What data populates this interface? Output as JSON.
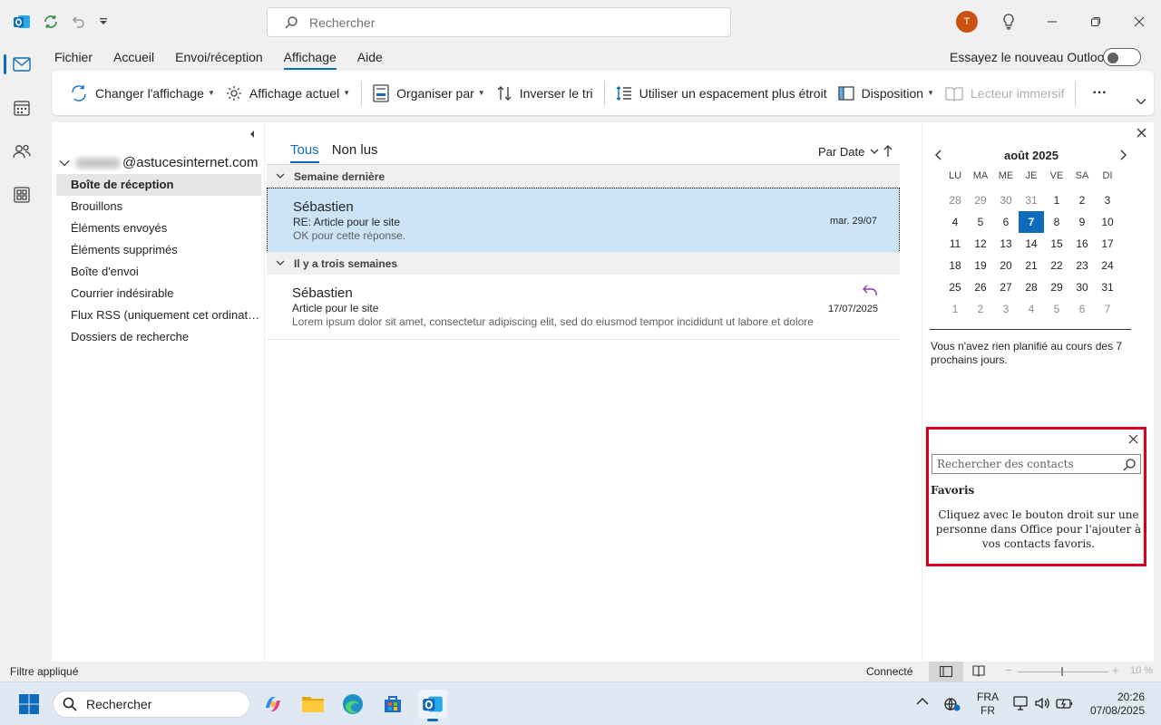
{
  "search": {
    "placeholder": "Rechercher"
  },
  "user": {
    "initial": "T"
  },
  "menu": [
    "Fichier",
    "Accueil",
    "Envoi/réception",
    "Affichage",
    "Aide"
  ],
  "try_new": "Essayez le nouveau Outlook",
  "ribbon": {
    "change_view": "Changer l'affichage",
    "current_view": "Affichage actuel",
    "arrange_by": "Organiser par",
    "reverse_sort": "Inverser le tri",
    "compact": "Utiliser un espacement plus étroit",
    "layout": "Disposition",
    "immersive_reader": "Lecteur immersif",
    "more": "···"
  },
  "account": {
    "email_suffix": "@astucesinternet.com"
  },
  "folders": [
    "Boîte de réception",
    "Brouillons",
    "Éléments envoyés",
    "Éléments supprimés",
    "Boîte d'envoi",
    "Courrier indésirable",
    "Flux RSS (uniquement cet ordinate...",
    "Dossiers de recherche"
  ],
  "list": {
    "tab_all": "Tous",
    "tab_unread": "Non lus",
    "sort": "Par Date",
    "groups": [
      {
        "title": "Semaine dernière",
        "messages": [
          {
            "sender": "Sébastien",
            "subject": "RE: Article pour le site",
            "preview": "OK pour cette réponse.",
            "date": "mar. 29/07"
          }
        ]
      },
      {
        "title": "Il y a trois semaines",
        "messages": [
          {
            "sender": "Sébastien",
            "subject": "Article pour le site",
            "preview": "Lorem ipsum dolor sit amet, consectetur adipiscing elit, sed do eiusmod tempor incididunt ut labore et dolore",
            "date": "17/07/2025"
          }
        ]
      }
    ]
  },
  "calendar": {
    "month": "août 2025",
    "weekdays": [
      "LU",
      "MA",
      "ME",
      "JE",
      "VE",
      "SA",
      "DI"
    ],
    "days": [
      "28",
      "29",
      "30",
      "31",
      "1",
      "2",
      "3",
      "4",
      "5",
      "6",
      "7",
      "8",
      "9",
      "10",
      "11",
      "12",
      "13",
      "14",
      "15",
      "16",
      "17",
      "18",
      "19",
      "20",
      "21",
      "22",
      "23",
      "24",
      "25",
      "26",
      "27",
      "28",
      "29",
      "30",
      "31",
      "1",
      "2",
      "3",
      "4",
      "5",
      "6",
      "7"
    ],
    "dim_indices": [
      0,
      1,
      2,
      3,
      35,
      36,
      37,
      38,
      39,
      40,
      41
    ],
    "today_index": 10,
    "nothing_planned": "Vous n'avez rien planifié au cours des 7 prochains jours."
  },
  "people": {
    "search_placeholder": "Rechercher des contacts",
    "favorites_title": "Favoris",
    "favorites_text": "Cliquez avec le bouton droit sur une personne dans Office pour l'ajouter à vos contacts favoris."
  },
  "status": {
    "filter": "Filtre appliqué",
    "connection": "Connecté",
    "zoom": "10 %"
  },
  "taskbar": {
    "search": "Rechercher",
    "lang_1": "FRA",
    "lang_2": "FR",
    "time": "20:26",
    "date": "07/08/2025"
  },
  "colors": {
    "accent": "#0f6cbd",
    "highlight_box": "#d8001c",
    "selected_row": "#cce4f7",
    "avatar": "#ca5010"
  }
}
